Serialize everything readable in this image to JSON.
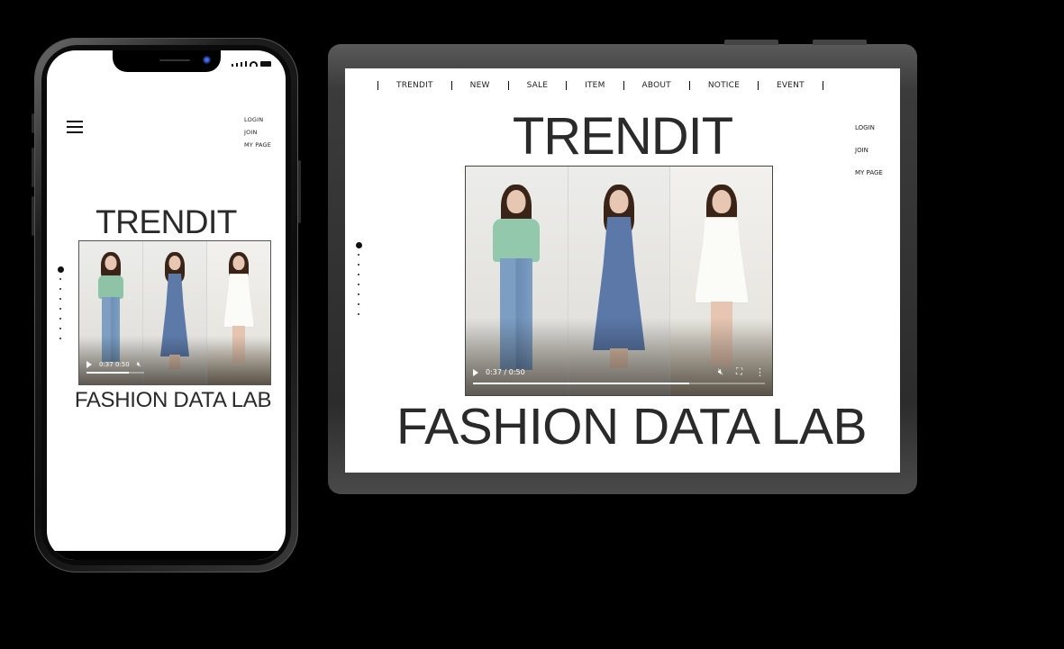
{
  "mobile": {
    "links": [
      "LOGIN",
      "JOIN",
      "MY PAGE"
    ],
    "title": "TRENDIT",
    "subtitle": "FASHION DATA LAB",
    "video": {
      "current_time": "0:37",
      "duration": "0:50",
      "time_display": "0:37 0:50",
      "progress": 0.74,
      "muted": true
    },
    "icons": [
      "hamburger-menu-icon",
      "front-camera-icon",
      "signal-icon",
      "wifi-icon",
      "battery-icon",
      "play-icon",
      "mute-icon"
    ]
  },
  "tablet": {
    "nav": [
      "TRENDIT",
      "NEW",
      "SALE",
      "ITEM",
      "ABOUT",
      "NOTICE",
      "EVENT"
    ],
    "title": "TRENDIT",
    "links": [
      "LOGIN",
      "JOIN",
      "MY PAGE"
    ],
    "subtitle": "FASHION DATA LAB",
    "video": {
      "current_time": "0:37",
      "duration": "0:50",
      "time_display": "0:37 / 0:50",
      "progress": 0.74,
      "muted": true
    },
    "icons": [
      "play-icon",
      "mute-icon",
      "fullscreen-icon",
      "more-options-icon"
    ]
  },
  "colors": {
    "background": "#000000",
    "text": "#2a2a2a",
    "screen": "#ffffff"
  }
}
